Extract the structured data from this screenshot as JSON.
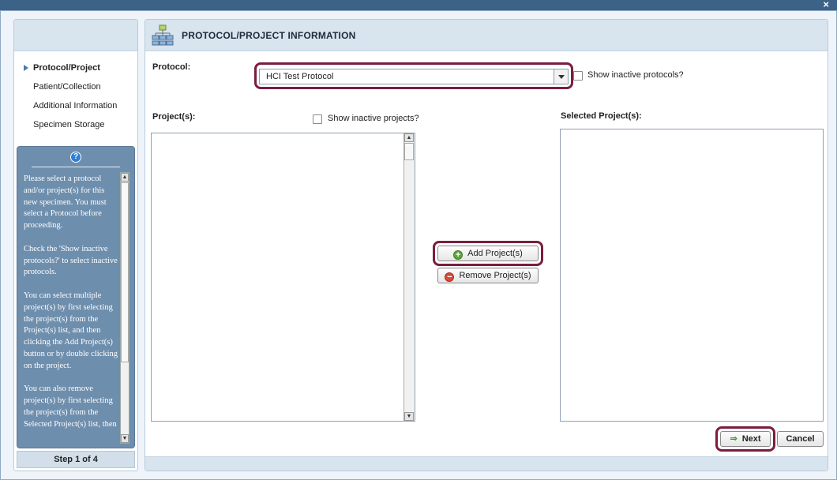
{
  "window": {
    "close_label": "×"
  },
  "wizard": {
    "steps": [
      {
        "label": "Protocol/Project",
        "active": true
      },
      {
        "label": "Patient/Collection",
        "active": false
      },
      {
        "label": "Additional Information",
        "active": false
      },
      {
        "label": "Specimen Storage",
        "active": false
      }
    ],
    "step_indicator": "Step 1 of 4",
    "help_icon": "?",
    "help_paragraphs": [
      "Please select a protocol and/or project(s) for this new specimen. You must select a Protocol before proceeding.",
      "Check the 'Show inactive protocols?' to select inactive protocols.",
      "You can select multiple project(s) by first selecting the project(s) from the Project(s) list, and then clicking the Add Project(s) button or by double clicking on the project.",
      "You can also remove project(s) by first selecting the project(s) from the Selected Project(s) list, then"
    ]
  },
  "main": {
    "title": "PROTOCOL/PROJECT INFORMATION",
    "header_icon": "hierarchy-icon",
    "protocol_label": "Protocol:",
    "protocol_value": "HCI Test Protocol",
    "show_inactive_protocols": "Show inactive protocols?",
    "projects_label": "Project(s):",
    "show_inactive_projects": "Show inactive projects?",
    "selected_projects_label": "Selected Project(s):",
    "add_button": "Add Project(s)",
    "remove_button": "Remove Project(s)",
    "next_button": "Next",
    "cancel_button": "Cancel"
  },
  "colors": {
    "highlight": "#7a1d3f",
    "header_bg": "#d8e4ee",
    "help_bg": "#6e8ead",
    "titlebar": "#3d6288"
  }
}
